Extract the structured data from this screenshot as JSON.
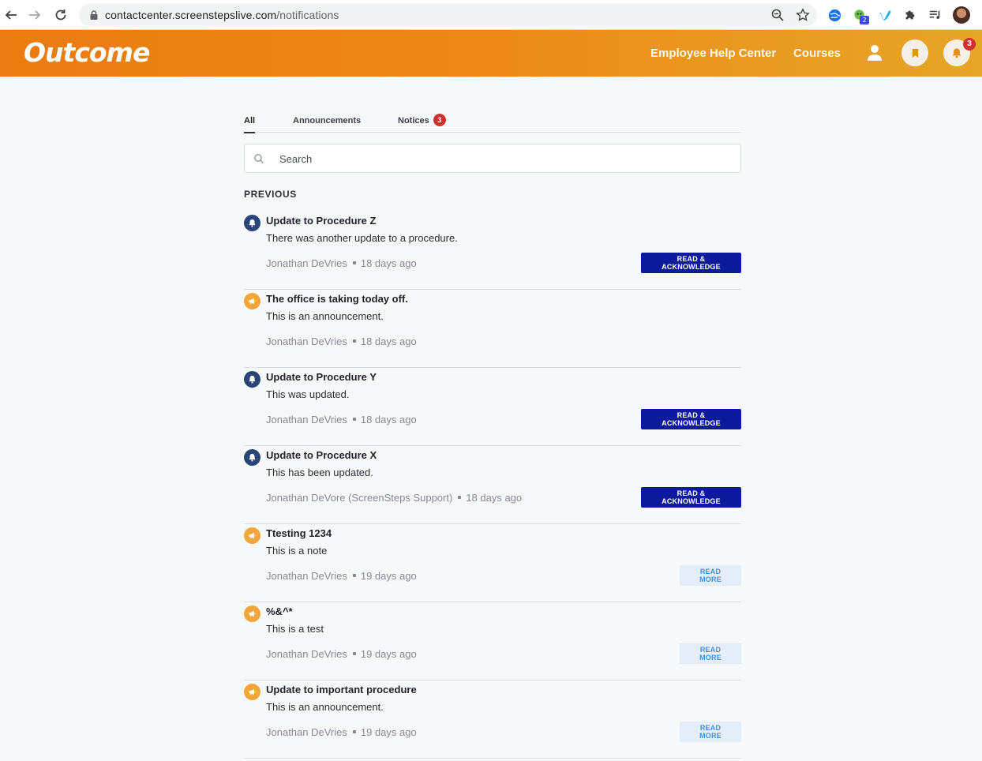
{
  "browser": {
    "url_host": "contactcenter.screenstepslive.com",
    "url_path": "/notifications",
    "extension_badge": "2"
  },
  "app": {
    "logo": "Outcome",
    "nav": {
      "help_center": "Employee Help Center",
      "courses": "Courses"
    },
    "notification_badge": "3",
    "colors": {
      "header_start": "#ea7b10",
      "header_end": "#e6a627",
      "ack_button": "#0d1a9b",
      "badge": "#d32f2f"
    }
  },
  "tabs": {
    "all": "All",
    "announcements": "Announcements",
    "notices": "Notices",
    "notices_badge": "3"
  },
  "search": {
    "placeholder": "Search"
  },
  "section_title": "PREVIOUS",
  "items": [
    {
      "type": "notice",
      "icon": "bell-icon",
      "title": "Update to Procedure Z",
      "body": "There was another update to a procedure.",
      "author": "Jonathan DeVries",
      "time": "18 days ago",
      "action": "READ & ACKNOWLEDGE"
    },
    {
      "type": "announcement",
      "icon": "megaphone-icon",
      "title": "The office is taking today off.",
      "body": "This is an announcement.",
      "author": "Jonathan DeVries",
      "time": "18 days ago",
      "action": ""
    },
    {
      "type": "notice",
      "icon": "bell-icon",
      "title": "Update to Procedure Y",
      "body": "This was updated.",
      "author": "Jonathan DeVries",
      "time": "18 days ago",
      "action": "READ & ACKNOWLEDGE"
    },
    {
      "type": "notice",
      "icon": "bell-icon",
      "title": "Update to Procedure X",
      "body": "This has been updated.",
      "author": "Jonathan DeVore (ScreenSteps Support)",
      "time": "18 days ago",
      "action": "READ & ACKNOWLEDGE"
    },
    {
      "type": "announcement",
      "icon": "megaphone-icon",
      "title": "Ttesting 1234",
      "body": "This is a note",
      "author": "Jonathan DeVries",
      "time": "19 days ago",
      "action": "READ MORE"
    },
    {
      "type": "announcement",
      "icon": "megaphone-icon",
      "title": "%&^*",
      "body": "This is a test",
      "author": "Jonathan DeVries",
      "time": "19 days ago",
      "action": "READ MORE"
    },
    {
      "type": "announcement",
      "icon": "megaphone-icon",
      "title": "Update to important procedure",
      "body": "This is an announcement.",
      "author": "Jonathan DeVries",
      "time": "19 days ago",
      "action": "READ MORE"
    }
  ]
}
